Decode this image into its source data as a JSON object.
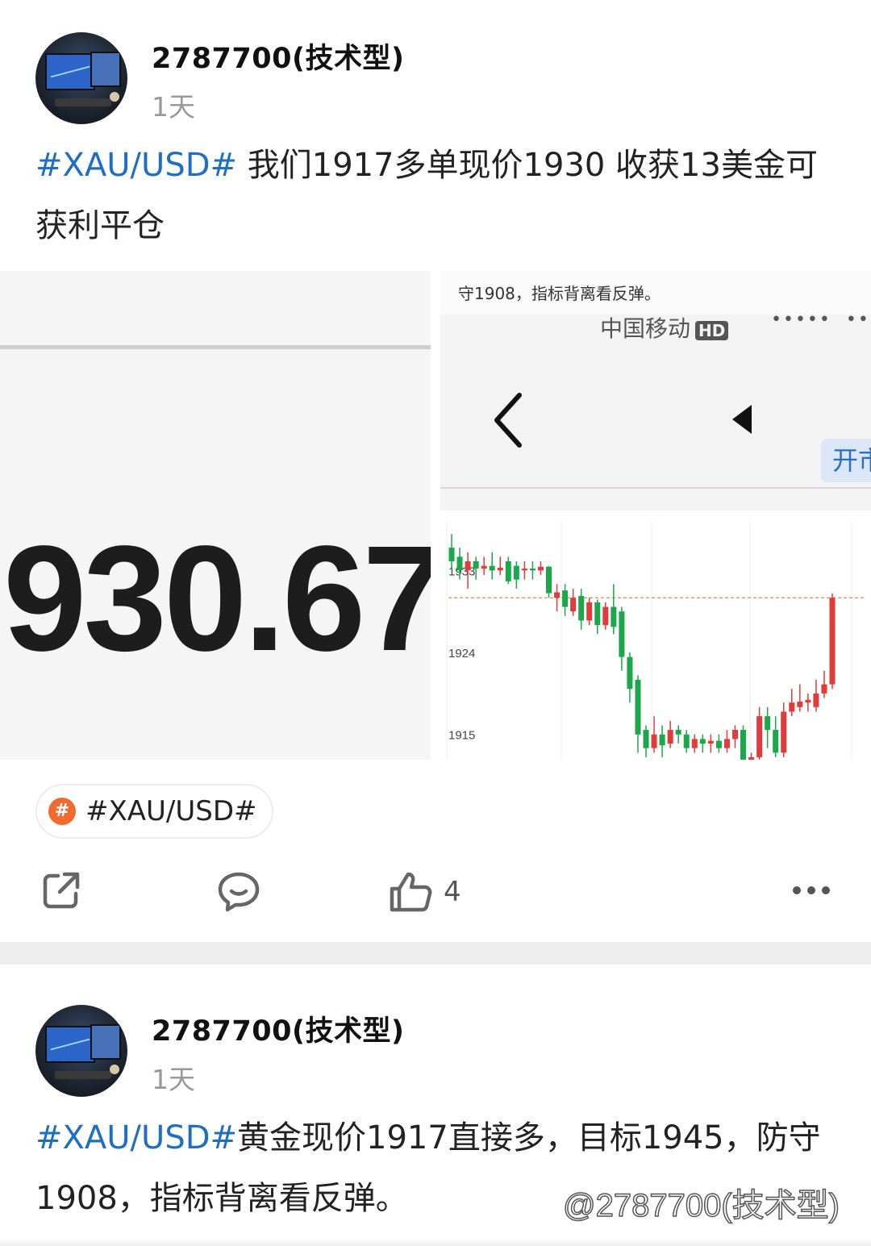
{
  "posts": [
    {
      "username": "2787700(技术型)",
      "time": "1天",
      "hashtag": "#XAU/USD#",
      "text": " 我们1917多单现价1930 收获13美金可获利平仓",
      "images": {
        "left": {
          "price_text": "930.67"
        },
        "right_top": {
          "strip_text": "守1908，指标背离看反弹。",
          "carrier": "中国移动",
          "carrier_badge": "HD",
          "open_button": "开市"
        },
        "right_bottom": {
          "chart_data": {
            "type": "candlestick",
            "y_ticks": [
              "1933",
              "1924",
              "1915"
            ],
            "reference_line": 1930,
            "candles": [
              {
                "o": 1935.5,
                "c": 1934.0,
                "h": 1937.0,
                "l": 1933.0,
                "up": false
              },
              {
                "o": 1934.5,
                "c": 1933.0,
                "h": 1935.5,
                "l": 1932.0,
                "up": false
              },
              {
                "o": 1933.0,
                "c": 1934.0,
                "h": 1935.0,
                "l": 1931.0,
                "up": true
              },
              {
                "o": 1934.0,
                "c": 1933.2,
                "h": 1934.5,
                "l": 1932.0,
                "up": false
              },
              {
                "o": 1933.2,
                "c": 1933.5,
                "h": 1934.5,
                "l": 1932.5,
                "up": true
              },
              {
                "o": 1933.5,
                "c": 1933.0,
                "h": 1935.0,
                "l": 1932.0,
                "up": false
              },
              {
                "o": 1933.0,
                "c": 1933.3,
                "h": 1934.5,
                "l": 1932.5,
                "up": true
              },
              {
                "o": 1934.0,
                "c": 1931.8,
                "h": 1934.5,
                "l": 1931.5,
                "up": false
              },
              {
                "o": 1933.5,
                "c": 1932.0,
                "h": 1934.0,
                "l": 1931.0,
                "up": false
              },
              {
                "o": 1933.0,
                "c": 1933.2,
                "h": 1934.0,
                "l": 1932.0,
                "up": true
              },
              {
                "o": 1933.2,
                "c": 1933.0,
                "h": 1934.0,
                "l": 1932.0,
                "up": false
              },
              {
                "o": 1933.0,
                "c": 1933.4,
                "h": 1934.0,
                "l": 1932.5,
                "up": true
              },
              {
                "o": 1933.4,
                "c": 1930.5,
                "h": 1933.5,
                "l": 1930.0,
                "up": false
              },
              {
                "o": 1930.0,
                "c": 1930.6,
                "h": 1931.5,
                "l": 1928.5,
                "up": true
              },
              {
                "o": 1930.8,
                "c": 1929.0,
                "h": 1931.5,
                "l": 1928.0,
                "up": false
              },
              {
                "o": 1928.5,
                "c": 1930.0,
                "h": 1931.0,
                "l": 1928.0,
                "up": true
              },
              {
                "o": 1930.2,
                "c": 1927.5,
                "h": 1931.0,
                "l": 1926.5,
                "up": false
              },
              {
                "o": 1927.5,
                "c": 1929.5,
                "h": 1930.0,
                "l": 1927.0,
                "up": true
              },
              {
                "o": 1929.5,
                "c": 1927.0,
                "h": 1929.8,
                "l": 1926.0,
                "up": false
              },
              {
                "o": 1927.0,
                "c": 1929.0,
                "h": 1929.5,
                "l": 1926.5,
                "up": true
              },
              {
                "o": 1929.0,
                "c": 1926.8,
                "h": 1931.5,
                "l": 1926.0,
                "up": false
              },
              {
                "o": 1928.5,
                "c": 1923.5,
                "h": 1929.0,
                "l": 1922.0,
                "up": false
              },
              {
                "o": 1923.5,
                "c": 1920.0,
                "h": 1924.0,
                "l": 1918.5,
                "up": false
              },
              {
                "o": 1921.0,
                "c": 1915.0,
                "h": 1921.5,
                "l": 1913.0,
                "up": false
              },
              {
                "o": 1915.5,
                "c": 1913.5,
                "h": 1916.0,
                "l": 1912.5,
                "up": false
              },
              {
                "o": 1913.5,
                "c": 1915.0,
                "h": 1917.0,
                "l": 1913.0,
                "up": true
              },
              {
                "o": 1915.0,
                "c": 1913.8,
                "h": 1916.0,
                "l": 1912.5,
                "up": false
              },
              {
                "o": 1914.0,
                "c": 1915.5,
                "h": 1916.5,
                "l": 1913.5,
                "up": true
              },
              {
                "o": 1915.5,
                "c": 1915.0,
                "h": 1916.0,
                "l": 1914.0,
                "up": false
              },
              {
                "o": 1915.0,
                "c": 1913.5,
                "h": 1915.5,
                "l": 1913.0,
                "up": false
              },
              {
                "o": 1913.5,
                "c": 1914.5,
                "h": 1915.0,
                "l": 1913.0,
                "up": true
              },
              {
                "o": 1914.5,
                "c": 1914.0,
                "h": 1915.0,
                "l": 1913.0,
                "up": false
              },
              {
                "o": 1914.0,
                "c": 1914.3,
                "h": 1915.0,
                "l": 1913.0,
                "up": true
              },
              {
                "o": 1914.3,
                "c": 1913.5,
                "h": 1915.0,
                "l": 1913.0,
                "up": false
              },
              {
                "o": 1913.5,
                "c": 1914.5,
                "h": 1915.5,
                "l": 1913.0,
                "up": true
              },
              {
                "o": 1914.5,
                "c": 1915.5,
                "h": 1916.0,
                "l": 1913.5,
                "up": true
              },
              {
                "o": 1915.5,
                "c": 1912.0,
                "h": 1916.0,
                "l": 1911.5,
                "up": false
              },
              {
                "o": 1912.0,
                "c": 1912.5,
                "h": 1913.0,
                "l": 1911.5,
                "up": true
              },
              {
                "o": 1912.5,
                "c": 1917.0,
                "h": 1918.0,
                "l": 1912.0,
                "up": true
              },
              {
                "o": 1917.0,
                "c": 1915.5,
                "h": 1918.0,
                "l": 1913.5,
                "up": false
              },
              {
                "o": 1915.5,
                "c": 1913.0,
                "h": 1917.0,
                "l": 1912.5,
                "up": false
              },
              {
                "o": 1913.0,
                "c": 1917.5,
                "h": 1918.5,
                "l": 1912.5,
                "up": true
              },
              {
                "o": 1917.5,
                "c": 1918.5,
                "h": 1920.0,
                "l": 1917.0,
                "up": true
              },
              {
                "o": 1918.0,
                "c": 1918.6,
                "h": 1920.5,
                "l": 1917.5,
                "up": true
              },
              {
                "o": 1918.5,
                "c": 1918.8,
                "h": 1919.5,
                "l": 1917.5,
                "up": true
              },
              {
                "o": 1918.0,
                "c": 1919.5,
                "h": 1921.0,
                "l": 1917.5,
                "up": true
              },
              {
                "o": 1919.5,
                "c": 1920.5,
                "h": 1922.0,
                "l": 1919.0,
                "up": true
              },
              {
                "o": 1920.5,
                "c": 1930.0,
                "h": 1930.5,
                "l": 1920.0,
                "up": true
              }
            ]
          }
        }
      },
      "topic_tag": "#XAU/USD#",
      "like_count": "4"
    },
    {
      "username": "2787700(技术型)",
      "time": "1天",
      "hashtag": "#XAU/USD#",
      "text": "黄金现价1917直接多，目标1945，防守1908，指标背离看反弹。"
    }
  ],
  "watermark": "@2787700(技术型)",
  "colors": {
    "hashtag": "#1e6fc2",
    "candle_up": "#e23b3b",
    "candle_down": "#1aa84a",
    "reference_line": "#e0a060"
  }
}
